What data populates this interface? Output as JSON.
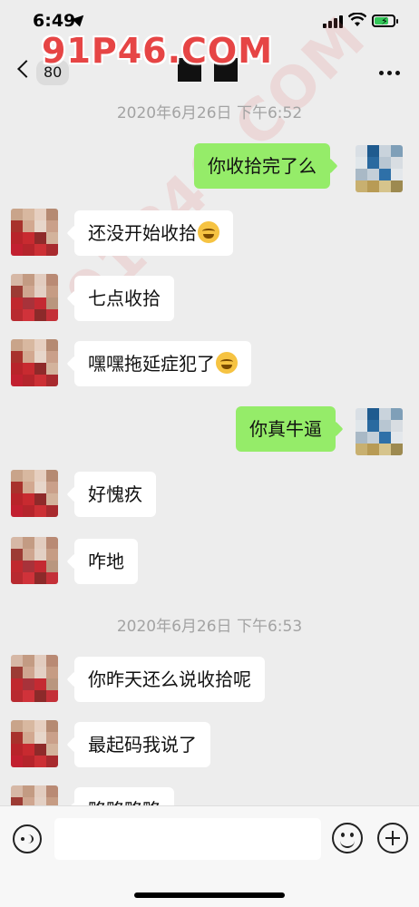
{
  "status_bar": {
    "time": "6:49",
    "battery_level": 0.75
  },
  "nav": {
    "unread_count": "80"
  },
  "watermark": {
    "text": "91P46.COM"
  },
  "messages": [
    {
      "type": "timestamp",
      "text": "2020年6月26日 下午6:52"
    },
    {
      "type": "message",
      "side": "right",
      "text": "你收拾完了么",
      "emoji": false
    },
    {
      "type": "message",
      "side": "left",
      "text": "还没开始收拾",
      "emoji": true
    },
    {
      "type": "message",
      "side": "left",
      "text": "七点收拾",
      "emoji": false
    },
    {
      "type": "message",
      "side": "left",
      "text": "嘿嘿拖延症犯了",
      "emoji": true
    },
    {
      "type": "message",
      "side": "right",
      "text": "你真牛逼",
      "emoji": false
    },
    {
      "type": "message",
      "side": "left",
      "text": "好愧疚",
      "emoji": false
    },
    {
      "type": "message",
      "side": "left",
      "text": "咋地",
      "emoji": false
    },
    {
      "type": "timestamp",
      "text": "2020年6月26日 下午6:53"
    },
    {
      "type": "message",
      "side": "left",
      "text": "你昨天还么说收拾呢",
      "emoji": false
    },
    {
      "type": "message",
      "side": "left",
      "text": "最起码我说了",
      "emoji": false
    },
    {
      "type": "message",
      "side": "left",
      "text": "略略略略",
      "emoji": false
    }
  ],
  "input": {
    "value": ""
  },
  "icons": {
    "back": "chevron-left-icon",
    "more": "more-dots-icon",
    "voice": "voice-icon",
    "emoji": "emoji-icon",
    "add": "plus-icon"
  },
  "colors": {
    "background": "#ededed",
    "bubble_self": "#95ec69",
    "bubble_other": "#ffffff",
    "watermark": "#e64545"
  }
}
